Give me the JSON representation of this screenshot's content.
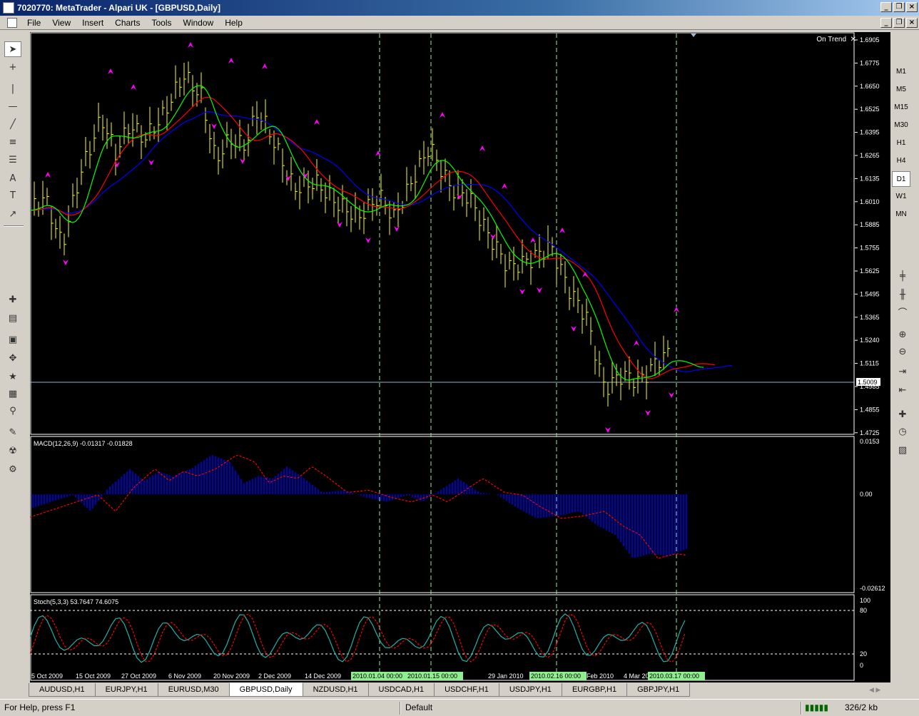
{
  "window": {
    "title": "7020770: MetaTrader - Alpari UK - [GBPUSD,Daily]"
  },
  "menu": {
    "items": [
      "File",
      "View",
      "Insert",
      "Charts",
      "Tools",
      "Window",
      "Help"
    ]
  },
  "timeframes": {
    "items": [
      "M1",
      "M5",
      "M15",
      "M30",
      "H1",
      "H4",
      "D1",
      "W1",
      "MN"
    ],
    "selected": "D1"
  },
  "chart": {
    "indicator_label": "On Trend",
    "price_axis": [
      "1.6905",
      "1.6775",
      "1.6650",
      "1.6525",
      "1.6395",
      "1.6265",
      "1.6135",
      "1.6010",
      "1.5885",
      "1.5755",
      "1.5625",
      "1.5495",
      "1.5365",
      "1.5240",
      "1.5115",
      "1.4985",
      "1.4855",
      "1.4725"
    ],
    "current_price": "1.5009",
    "macd_label": "MACD(12,26,9) -0.01317 -0.01828",
    "macd_axis": [
      "0.0153",
      "0.00",
      "-0.02612"
    ],
    "stoch_label": "Stoch(5,3,3) 53.7647 74.6075",
    "stoch_axis": [
      "100",
      "80",
      "20",
      "0"
    ],
    "date_axis": [
      "5 Oct 2009",
      "15 Oct 2009",
      "27 Oct 2009",
      "6 Nov 2009",
      "20 Nov 2009",
      "2 Dec 2009",
      "14 Dec 2009",
      "2010",
      "29 Jan 2010",
      "Feb 2010",
      "4 Mar 2010"
    ],
    "vline_labels": [
      "2010.01.04 00:00",
      "2010.01.15 00:00",
      "2010.02.16 00:00",
      "2010.03.17 00:00"
    ],
    "colors": {
      "bars": "#ffff00",
      "fast_ma": "#00ff00",
      "mid_ma": "#ff0000",
      "slow_ma": "#0000ff",
      "arrows": "#ff00ff",
      "macd_hist": "#0000ff",
      "macd_signal": "#ff0000",
      "stoch_main": "#20b2aa",
      "stoch_signal": "#ff0000",
      "vlines": "#90ee90"
    }
  },
  "tabs": {
    "items": [
      "AUDUSD,H1",
      "EURJPY,H1",
      "EURUSD,M30",
      "GBPUSD,Daily",
      "NZDUSD,H1",
      "USDCAD,H1",
      "USDCHF,H1",
      "USDJPY,H1",
      "EURGBP,H1",
      "GBPJPY,H1"
    ],
    "active": "GBPUSD,Daily"
  },
  "status": {
    "help": "For Help, press F1",
    "profile": "Default",
    "traffic": "326/2 kb"
  }
}
